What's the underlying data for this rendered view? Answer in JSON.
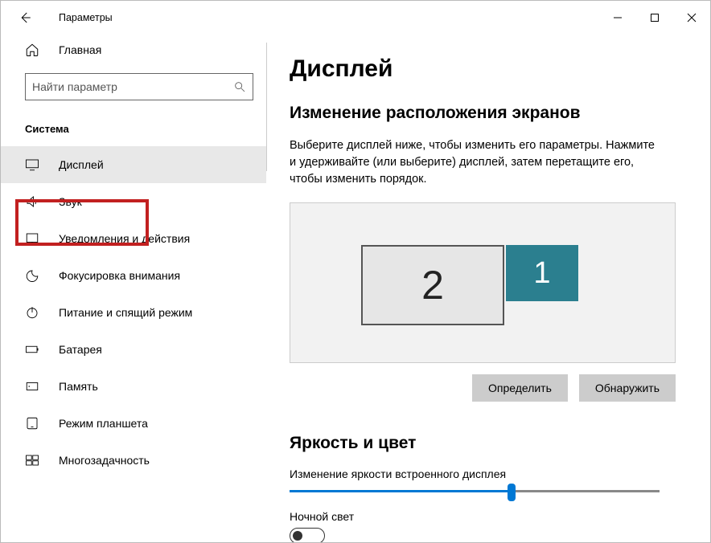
{
  "app_title": "Параметры",
  "home_label": "Главная",
  "search_placeholder": "Найти параметр",
  "group_title": "Система",
  "nav": [
    {
      "label": "Дисплей",
      "selected": true,
      "icon": "monitor"
    },
    {
      "label": "Звук",
      "selected": false,
      "icon": "sound"
    },
    {
      "label": "Уведомления и действия",
      "selected": false,
      "icon": "notifications"
    },
    {
      "label": "Фокусировка внимания",
      "selected": false,
      "icon": "focus"
    },
    {
      "label": "Питание и спящий режим",
      "selected": false,
      "icon": "power"
    },
    {
      "label": "Батарея",
      "selected": false,
      "icon": "battery"
    },
    {
      "label": "Память",
      "selected": false,
      "icon": "storage"
    },
    {
      "label": "Режим планшета",
      "selected": false,
      "icon": "tablet"
    },
    {
      "label": "Многозадачность",
      "selected": false,
      "icon": "multitask"
    }
  ],
  "page_title": "Дисплей",
  "arrange": {
    "heading": "Изменение расположения экранов",
    "desc": "Выберите дисплей ниже, чтобы изменить его параметры. Нажмите и удерживайте (или выберите) дисплей, затем перетащите его, чтобы изменить порядок.",
    "monitors": [
      {
        "id": "2",
        "primary": false
      },
      {
        "id": "1",
        "primary": true
      }
    ],
    "identify_label": "Определить",
    "detect_label": "Обнаружить"
  },
  "brightness": {
    "heading": "Яркость и цвет",
    "label": "Изменение яркости встроенного дисплея",
    "value_percent": 60
  },
  "night_light": {
    "label": "Ночной свет",
    "enabled": false
  }
}
